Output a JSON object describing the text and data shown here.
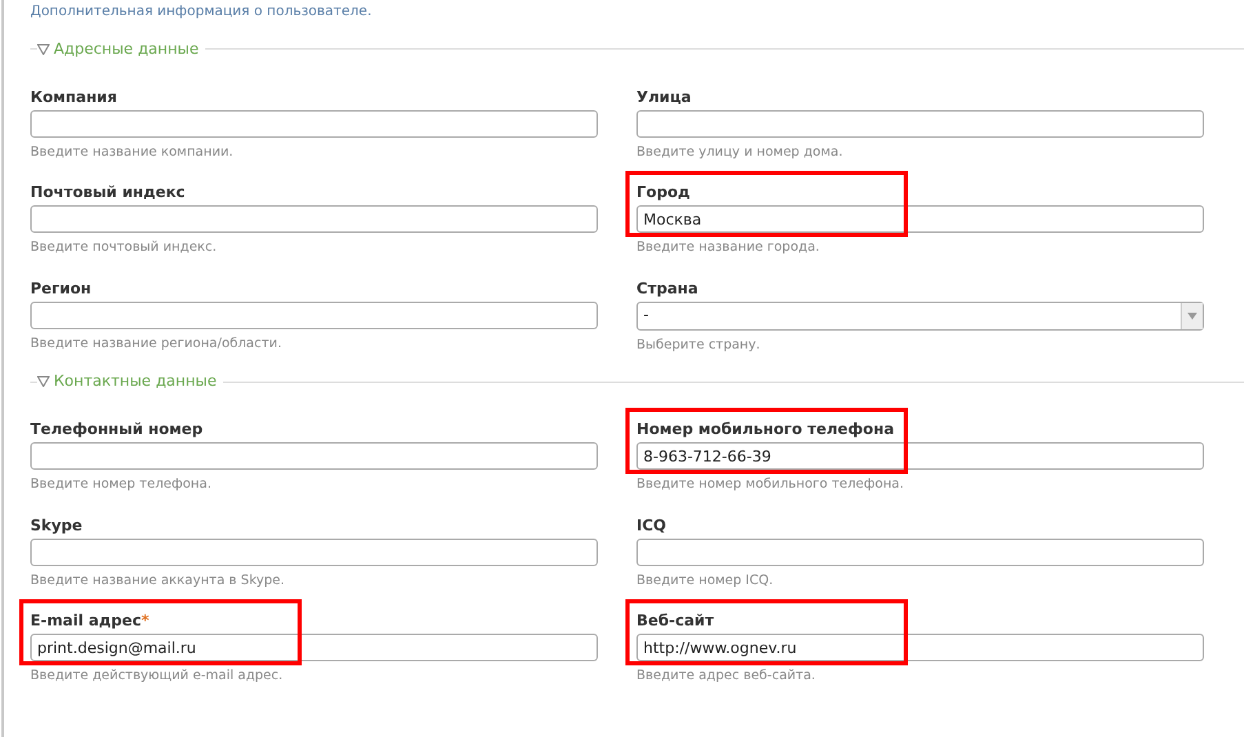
{
  "description": "Дополнительная информация о пользователе.",
  "sections": [
    {
      "title": "Адресные данные",
      "expanded": true,
      "fields": [
        {
          "label": "Компания",
          "kind": "text",
          "hint": "Введите название компании.",
          "highlighted": false
        },
        {
          "label": "Улица",
          "kind": "text",
          "hint": "Введите улицу и номер дома.",
          "highlighted": false
        },
        {
          "label": "Почтовый индекс",
          "kind": "text",
          "hint": "Введите почтовый индекс.",
          "highlighted": false
        },
        {
          "label": "Город",
          "kind": "text",
          "value": "Москва",
          "hint": "Введите название города.",
          "highlighted": true
        },
        {
          "label": "Регион",
          "kind": "text",
          "hint": "Введите название региона/области.",
          "highlighted": false
        },
        {
          "label": "Страна",
          "kind": "select",
          "value": "-",
          "hint": "Выберите страну.",
          "highlighted": false
        }
      ]
    },
    {
      "title": "Контактные данные",
      "expanded": true,
      "fields": [
        {
          "label": "Телефонный номер",
          "kind": "text",
          "hint": "Введите номер телефона.",
          "highlighted": false
        },
        {
          "label": "Номер мобильного телефона",
          "kind": "text",
          "value": "8-963-712-66-39",
          "hint": "Введите номер мобильного телефона.",
          "highlighted": true
        },
        {
          "label": "Skype",
          "kind": "text",
          "hint": "Введите название аккаунта в Skype.",
          "highlighted": false
        },
        {
          "label": "ICQ",
          "kind": "text",
          "hint": "Введите номер ICQ.",
          "highlighted": false
        },
        {
          "label": "E-mail адрес",
          "required_mark": "*",
          "kind": "text",
          "value": "print.design@mail.ru",
          "hint": "Введите действующий e-mail адрес.",
          "highlighted": true
        },
        {
          "label": "Веб-сайт",
          "kind": "text",
          "value": "http://www.ognev.ru",
          "hint": "Введите адрес веб-сайта.",
          "highlighted": true
        }
      ]
    }
  ]
}
